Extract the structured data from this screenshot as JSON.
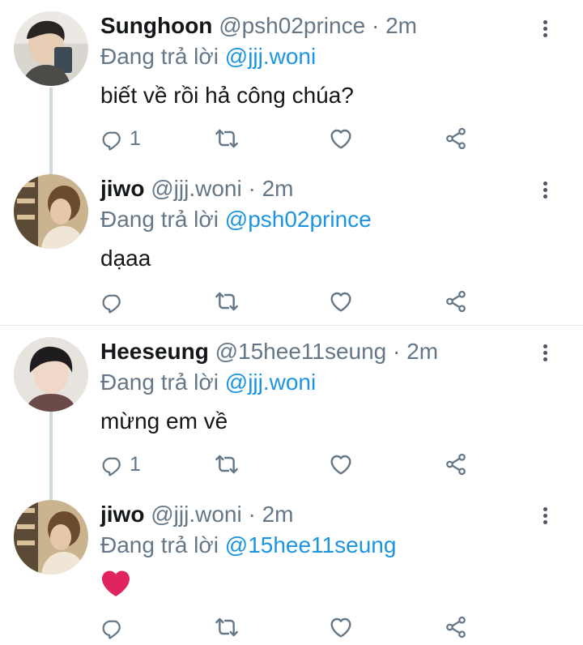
{
  "tweets": [
    {
      "name": "Sunghoon",
      "handle": "@psh02prince",
      "separator": "·",
      "time": "2m",
      "reply_prefix": "Đang trả lời",
      "reply_to": "@jjj.woni",
      "text": "biết về rồi hả công chúa?",
      "reply_count": "1"
    },
    {
      "name": "jiwo",
      "handle": "@jjj.woni",
      "separator": "·",
      "time": "2m",
      "reply_prefix": "Đang trả lời",
      "reply_to": "@psh02prince",
      "text": "dạaa",
      "reply_count": ""
    },
    {
      "name": "Heeseung",
      "handle": "@15hee11seung",
      "separator": "·",
      "time": "2m",
      "reply_prefix": "Đang trả lời",
      "reply_to": "@jjj.woni",
      "text": "mừng em về",
      "reply_count": "1"
    },
    {
      "name": "jiwo",
      "handle": "@jjj.woni",
      "separator": "·",
      "time": "2m",
      "reply_prefix": "Đang trả lời",
      "reply_to": "@15hee11seung",
      "text": "❤️",
      "reply_count": ""
    }
  ],
  "icons": {
    "reply": "reply-icon",
    "retweet": "retweet-icon",
    "like": "like-icon",
    "share": "share-icon",
    "more": "more-vertical-icon"
  },
  "colors": {
    "mention": "#1b95e0",
    "muted": "#657786",
    "icon": "#657786",
    "thread_line": "#cfd9de",
    "heart": "#e0245e"
  }
}
